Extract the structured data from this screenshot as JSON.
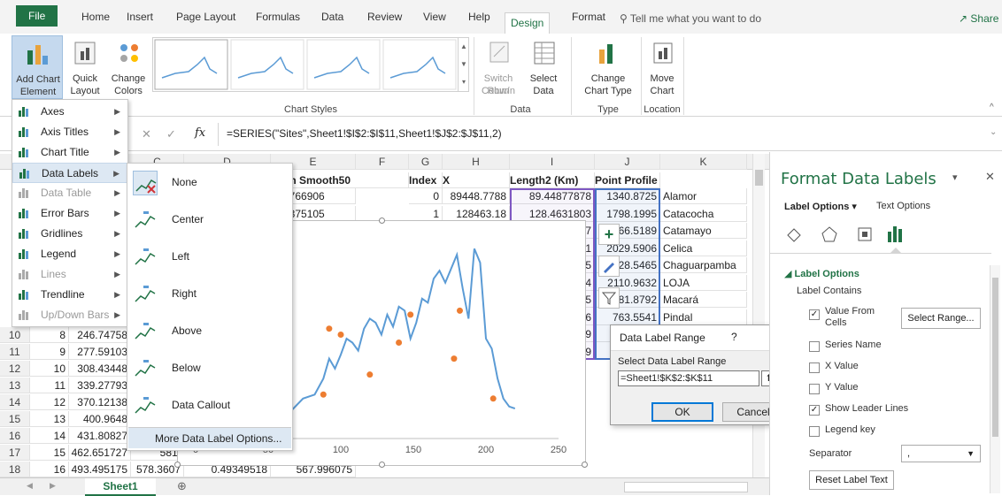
{
  "ribbon_tabs": [
    "File",
    "Home",
    "Insert",
    "Page Layout",
    "Formulas",
    "Data",
    "Review",
    "View",
    "Help",
    "Design",
    "Format"
  ],
  "tell_me": "Tell me what you want to do",
  "share": "Share",
  "ribbon": {
    "add_chart_element": [
      "Add Chart",
      "Element"
    ],
    "quick_layout": [
      "Quick",
      "Layout"
    ],
    "change_colors": [
      "Change",
      "Colors"
    ],
    "chart_styles_label": "Chart Styles",
    "switch_row_col": [
      "Switch Row/",
      "Column"
    ],
    "select_data": [
      "Select",
      "Data"
    ],
    "data_group": "Data",
    "change_chart_type": [
      "Change",
      "Chart Type"
    ],
    "type_group": "Type",
    "move_chart": [
      "Move",
      "Chart"
    ],
    "location_group": "Location"
  },
  "formula_bar": {
    "fx": "fx",
    "formula": "=SERIES(\"Sites\",Sheet1!$I$2:$I$11,Sheet1!$J$2:$J$11,2)"
  },
  "col_headers": [
    "C",
    "D",
    "E",
    "F",
    "G",
    "H",
    "I",
    "J",
    "K"
  ],
  "header_row": [
    "ation Smooth50",
    "Index",
    "X",
    "Length2 (Km)",
    "Point Profile",
    ""
  ],
  "rows": [
    {
      "e": "74.766906",
      "g": "0",
      "h": "89448.7788",
      "i": "89.44877878",
      "j": "1340.8725",
      "k": "Alamor"
    },
    {
      "e": "74.375105",
      "g": "1",
      "h": "128463.18",
      "i": "128.4631803",
      "j": "1798.1995",
      "k": "Catacocha"
    },
    {
      "e": "",
      "g": "",
      "h": "",
      "i": "7",
      "j": "66.5189",
      "k": "Catamayo"
    },
    {
      "e": "",
      "g": "",
      "h": "",
      "i": "1",
      "j": "2029.5906",
      "k": "Celica"
    },
    {
      "e": "",
      "g": "",
      "h": "",
      "i": "5",
      "j": "28.5465",
      "k": "Chaguarpamba"
    },
    {
      "e": "",
      "g": "",
      "h": "",
      "i": "4",
      "j": "2110.9632",
      "k": "LOJA"
    },
    {
      "e": "",
      "g": "",
      "h": "",
      "i": "5",
      "j": "81.8792",
      "k": "Macará"
    },
    {
      "e": "",
      "g": "",
      "h": "",
      "i": "6",
      "j": "763.5541",
      "k": "Pindal"
    },
    {
      "e": "",
      "g": "",
      "h": "",
      "i": "9",
      "j": "",
      "k": ""
    },
    {
      "e": "",
      "g": "",
      "h": "",
      "i": "9",
      "j": "",
      "k": ""
    }
  ],
  "left_rows": [
    {
      "n": "10",
      "b": "8",
      "c": "246.74758"
    },
    {
      "n": "11",
      "b": "9",
      "c": "277.59103"
    },
    {
      "n": "12",
      "b": "10",
      "c": "308.43448"
    },
    {
      "n": "13",
      "b": "11",
      "c": "339.27793"
    },
    {
      "n": "14",
      "b": "12",
      "c": "370.12138"
    },
    {
      "n": "15",
      "b": "13",
      "c": "400.9648"
    },
    {
      "n": "16",
      "b": "14",
      "c": "431.80827"
    },
    {
      "n": "17",
      "b": "15",
      "c": "462.651727",
      "d": "581."
    },
    {
      "n": "18",
      "b": "16",
      "c": "493.495175",
      "d": "578.3607",
      "e": "0.49349518",
      "f": "567.996075"
    }
  ],
  "menu": {
    "items": [
      {
        "label": "Axes",
        "arrow": true,
        "disabled": false
      },
      {
        "label": "Axis Titles",
        "arrow": true,
        "disabled": false
      },
      {
        "label": "Chart Title",
        "arrow": true,
        "disabled": false
      },
      {
        "label": "Data Labels",
        "arrow": true,
        "disabled": false
      },
      {
        "label": "Data Table",
        "arrow": true,
        "disabled": true
      },
      {
        "label": "Error Bars",
        "arrow": true,
        "disabled": false
      },
      {
        "label": "Gridlines",
        "arrow": true,
        "disabled": false
      },
      {
        "label": "Legend",
        "arrow": true,
        "disabled": false
      },
      {
        "label": "Lines",
        "arrow": true,
        "disabled": true
      },
      {
        "label": "Trendline",
        "arrow": true,
        "disabled": false
      },
      {
        "label": "Up/Down Bars",
        "arrow": true,
        "disabled": true
      }
    ]
  },
  "submenu": {
    "items": [
      "None",
      "Center",
      "Left",
      "Right",
      "Above",
      "Below",
      "Data Callout"
    ],
    "more": "More Data Label Options..."
  },
  "chart_data": {
    "type": "scatter",
    "title": "",
    "x_ticks": [
      "0",
      "50",
      "100",
      "150",
      "200",
      "250"
    ],
    "xlim": [
      0,
      250
    ],
    "line_series": {
      "x": [
        50,
        58,
        66,
        74,
        82,
        88,
        92,
        96,
        100,
        104,
        108,
        112,
        116,
        120,
        124,
        128,
        132,
        136,
        140,
        144,
        148,
        152,
        156,
        160,
        164,
        168,
        172,
        176,
        180,
        184,
        188,
        192,
        196,
        200,
        204,
        208,
        212,
        216,
        220
      ],
      "y": [
        0.1,
        0.12,
        0.14,
        0.2,
        0.22,
        0.3,
        0.4,
        0.35,
        0.42,
        0.5,
        0.48,
        0.44,
        0.55,
        0.6,
        0.58,
        0.52,
        0.62,
        0.56,
        0.66,
        0.64,
        0.5,
        0.58,
        0.7,
        0.68,
        0.8,
        0.84,
        0.78,
        0.85,
        0.92,
        0.75,
        0.6,
        0.95,
        0.88,
        0.5,
        0.45,
        0.3,
        0.2,
        0.16,
        0.15
      ]
    },
    "points": {
      "x": [
        88,
        92,
        100,
        120,
        140,
        148,
        178,
        182,
        205
      ],
      "y": [
        0.22,
        0.55,
        0.52,
        0.32,
        0.48,
        0.62,
        0.4,
        0.64,
        0.2
      ]
    },
    "grid": false,
    "colors": {
      "line": "#5b9bd5",
      "points": "#ed7d31"
    }
  },
  "dialog": {
    "title": "Data Label Range",
    "help": "?",
    "close": "✕",
    "label": "Select Data Label Range",
    "value": "=Sheet1!$K$2:$K$11",
    "ok": "OK",
    "cancel": "Cancel"
  },
  "pane": {
    "title": "Format Data Labels",
    "tab1": "Label Options",
    "tab2": "Text Options",
    "section": "Label Options",
    "contains": "Label Contains",
    "value_from_cells": [
      "Value From",
      "Cells"
    ],
    "select_range": "Select Range...",
    "options": [
      {
        "label": "Series Name",
        "checked": false
      },
      {
        "label": "X Value",
        "checked": false
      },
      {
        "label": "Y Value",
        "checked": false
      },
      {
        "label": "Show Leader Lines",
        "checked": true
      },
      {
        "label": "Legend key",
        "checked": false
      }
    ],
    "separator_label": "Separator",
    "separator_value": ",",
    "reset": "Reset Label Text"
  },
  "sheet_tab": "Sheet1"
}
